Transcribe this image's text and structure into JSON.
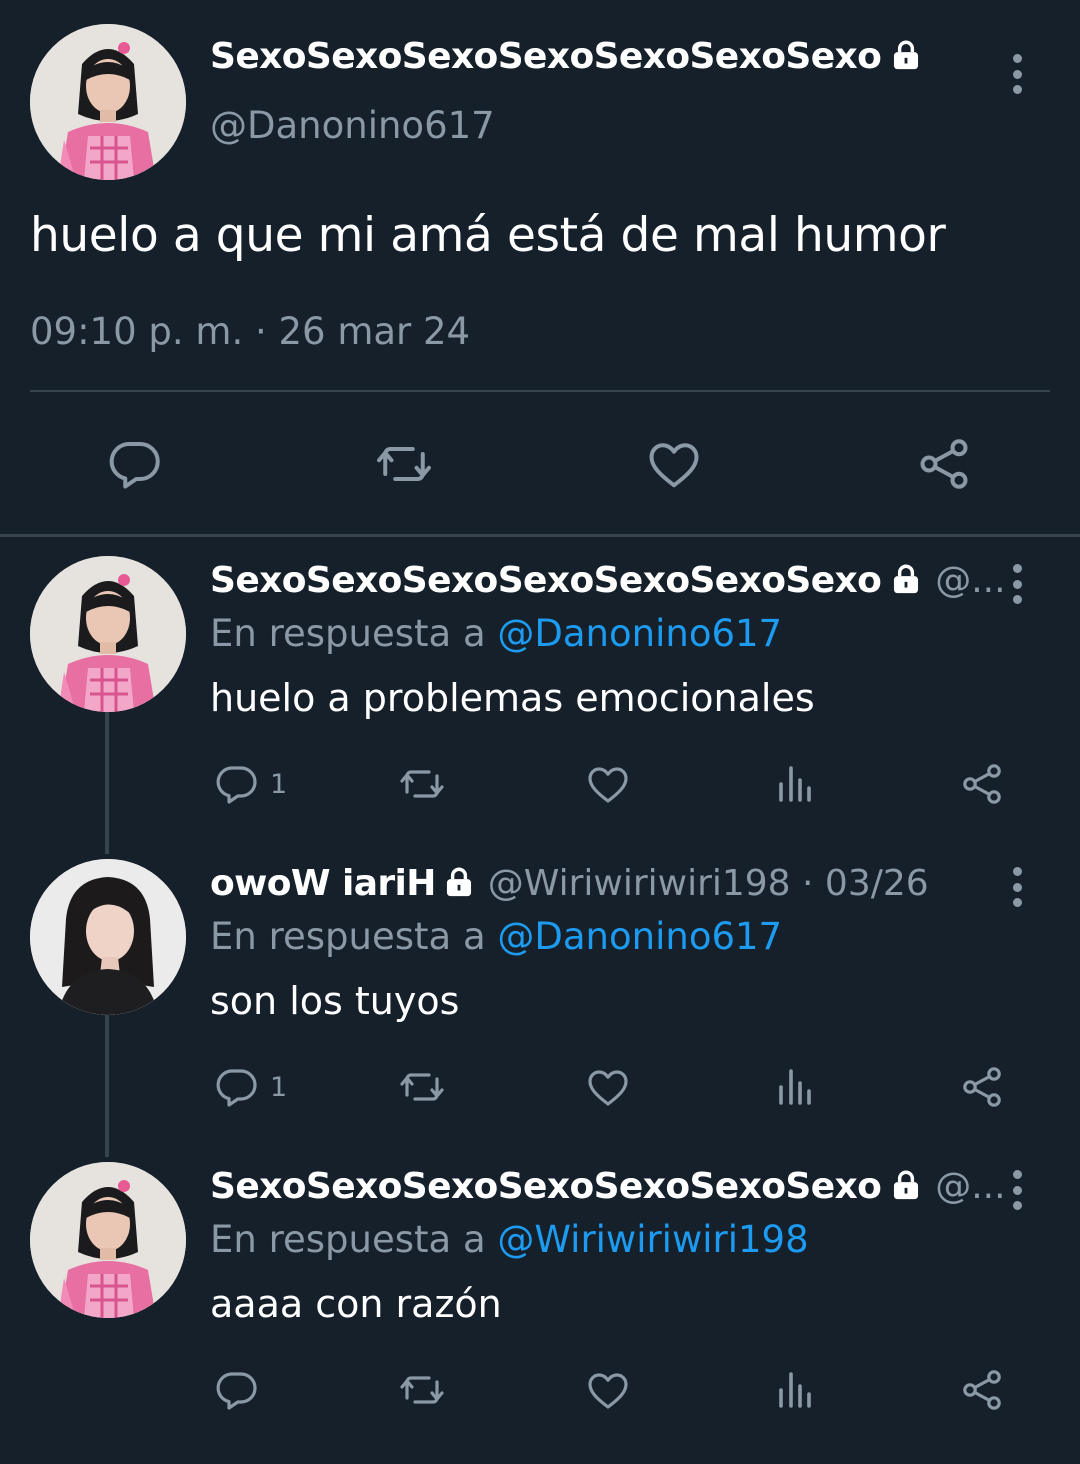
{
  "main_tweet": {
    "author_name": "SexoSexoSexoSexoSexoSexoSexo",
    "handle": "@Danonino617",
    "text": "huelo a que mi amá está de mal humor",
    "timestamp": "09:10 p. m. · 26 mar 24",
    "avatar": "avatar-photo-pink-outfit",
    "actions": [
      "reply-icon",
      "retweet-icon",
      "like-icon",
      "share-icon"
    ]
  },
  "replies": [
    {
      "author_name": "SexoSexoSexoSexoSexoSexoSexo",
      "meta": "@...",
      "reply_to_label": "En respuesta a",
      "reply_to_handle": "@Danonino617",
      "text": "huelo a problemas emocionales",
      "reply_count": "1",
      "avatar": "avatar-photo-pink-outfit"
    },
    {
      "author_name": "owoW iariH",
      "meta": "@Wiriwiriwiri198 · 03/26",
      "reply_to_label": "En respuesta a",
      "reply_to_handle": "@Danonino617",
      "text": "son los tuyos",
      "reply_count": "1",
      "avatar": "avatar-photo-dark-hair"
    },
    {
      "author_name": "SexoSexoSexoSexoSexoSexoSexo",
      "meta": "@...",
      "reply_to_label": "En respuesta a",
      "reply_to_handle": "@Wiriwiriwiri198",
      "text": "aaaa con razón",
      "reply_count": "",
      "avatar": "avatar-photo-pink-outfit"
    }
  ],
  "colors": {
    "background": "#15202b",
    "text": "#ffffff",
    "muted": "#8b98a5",
    "link": "#1d9bf0",
    "divider": "#38444d"
  }
}
